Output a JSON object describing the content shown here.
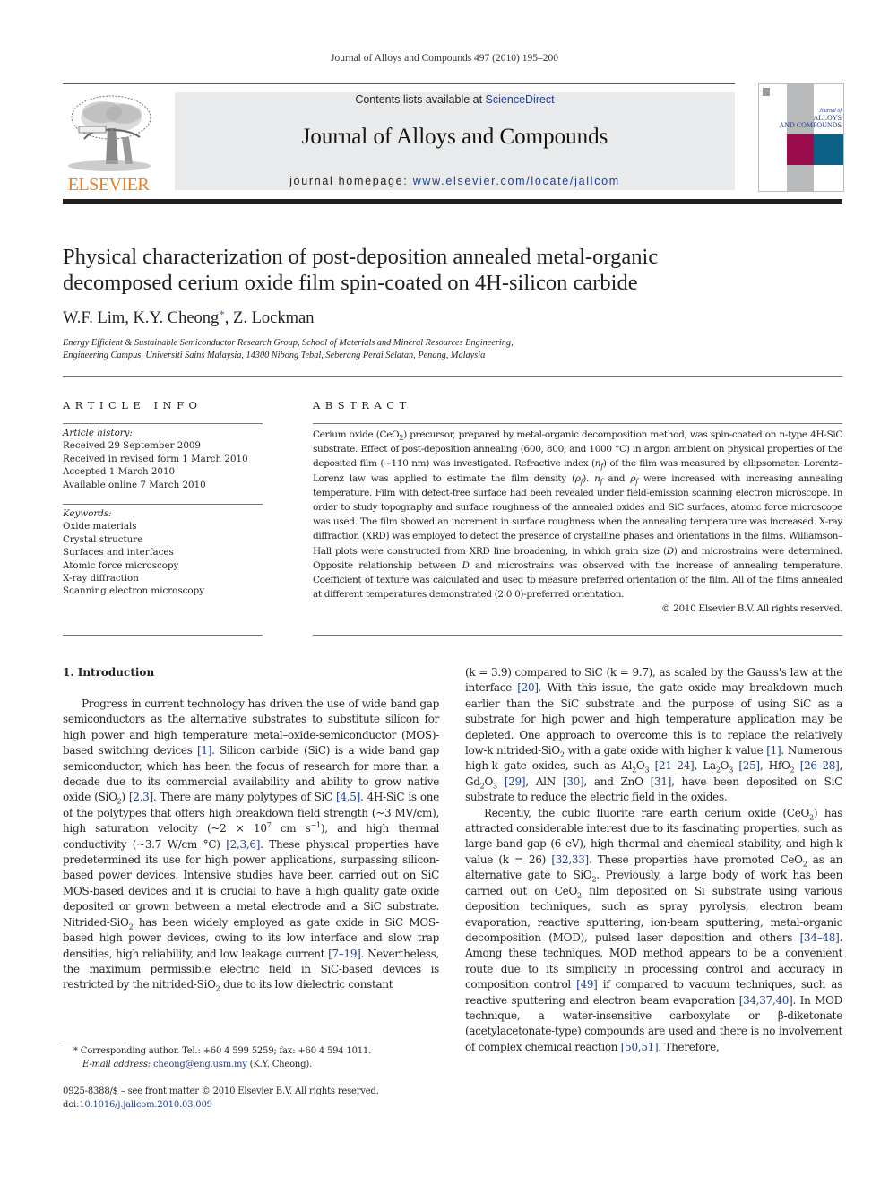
{
  "running_head": "Journal of Alloys and Compounds 497 (2010) 195–200",
  "masthead": {
    "contents_prefix": "Contents lists available at ",
    "contents_link": "ScienceDirect",
    "journal_title": "Journal of Alloys and Compounds",
    "homepage_prefix": "journal homepage: ",
    "homepage_link": "www.elsevier.com/locate/jallcom",
    "publisher_logo_text": "ELSEVIER",
    "cover_title_1": "Journal of",
    "cover_title_2": "ALLOYS",
    "cover_title_3": "AND COMPOUNDS",
    "colors": {
      "publisher_orange": "#f07e1f",
      "link_blue": "#1f3f94",
      "cover_magenta": "#9b0c4c",
      "cover_blue": "#0c6286",
      "cover_grey": "#b9babc",
      "masthead_bg": "#e9eaeb"
    }
  },
  "article": {
    "title_line1": "Physical characterization of post-deposition annealed metal-organic",
    "title_line2": "decomposed cerium oxide film spin-coated on 4H-silicon carbide",
    "authors": [
      {
        "name": "W.F. Lim",
        "sep": ", "
      },
      {
        "name": "K.Y. Cheong",
        "mark": "*",
        "sep": ", "
      },
      {
        "name": "Z. Lockman",
        "sep": ""
      }
    ],
    "affiliation_line1": "Energy Efficient & Sustainable Semiconductor Research Group, School of Materials and Mineral Resources Engineering,",
    "affiliation_line2": "Engineering Campus, Universiti Sains Malaysia, 14300 Nibong Tebal, Seberang Perai Selatan, Penang, Malaysia"
  },
  "article_info": {
    "heading": "ARTICLE INFO",
    "history_label": "Article history:",
    "history": [
      "Received 29 September 2009",
      "Received in revised form 1 March 2010",
      "Accepted 1 March 2010",
      "Available online 7 March 2010"
    ],
    "keywords_label": "Keywords:",
    "keywords": [
      "Oxide materials",
      "Crystal structure",
      "Surfaces and interfaces",
      "Atomic force microscopy",
      "X-ray diffraction",
      "Scanning electron microscopy"
    ]
  },
  "abstract": {
    "heading": "ABSTRACT",
    "p1": "Cerium oxide (CeO",
    "p1_sub": "2",
    "p2": ") precursor, prepared by metal-organic decomposition method, was spin-coated on n-type 4H-SiC substrate. Effect of post-deposition annealing (600, 800, and 1000 °C) in argon ambient on physical properties of the deposited film (~110 nm) was investigated. Refractive index (",
    "nf": "n",
    "f": "f",
    "p3": ") of the film was measured by ellipsometer. Lorentz–Lorenz law was applied to estimate the film density (",
    "rho": "ρ",
    "p4": "). ",
    "p5": " and ",
    "p6": " were increased with increasing annealing temperature. Film with defect-free surface had been revealed under field-emission scanning electron microscope. In order to study topography and surface roughness of the annealed oxides and SiC surfaces, atomic force microscope was used. The film showed an increment in surface roughness when the annealing temperature was increased. X-ray diffraction (XRD) was employed to detect the presence of crystalline phases and orientations in the films. Williamson–Hall plots were constructed from XRD line broadening, in which grain size (",
    "D": "D",
    "p7": ") and microstrains were determined. Opposite relationship between ",
    "p8": " and microstrains was observed with the increase of annealing temperature. Coefficient of texture was calculated and used to measure preferred orientation of the film. All of the films annealed at different temperatures demonstrated (2 0 0)-preferred orientation.",
    "copyright": "© 2010 Elsevier B.V. All rights reserved."
  },
  "intro": {
    "heading": "1.  Introduction",
    "left": {
      "a": "Progress in current technology has driven the use of wide band gap semiconductors as the alternative substrates to substitute silicon for high power and high temperature metal–oxide-semiconductor (MOS)-based switching devices ",
      "r1": "[1]",
      "b": ". Silicon carbide (SiC) is a wide band gap semiconductor, which has been the focus of research for more than a decade due to its commercial availability and ability to grow native oxide (SiO",
      "c": ") ",
      "r2": "[2,3]",
      "d": ". There are many polytypes of SiC ",
      "r3": "[4,5]",
      "e": ". 4H-SiC is one of the polytypes that offers high breakdown field strength (~3 MV/cm), high saturation velocity (~2 × 10",
      "exp7": "7",
      "f": " cm s",
      "expm1": "−1",
      "g": "), and high thermal conductivity (~3.7 W/cm °C) ",
      "r4": "[2,3,6]",
      "h": ". These physical properties have predetermined its use for high power applications, surpassing silicon-based power devices. Intensive studies have been carried out on SiC MOS-based devices and it is crucial to have a high quality gate oxide deposited or grown between a metal electrode and a SiC substrate. Nitrided-SiO",
      "i": " has been widely employed as gate oxide in SiC MOS-based high power devices, owing to its low interface and slow trap densities, high reliability, and low leakage current ",
      "r5": "[7–19]",
      "j": ". Nevertheless, the maximum permissible electric field in SiC-based devices is restricted by the nitrided-SiO",
      "k": " due to its low dielectric constant"
    },
    "right": {
      "a": "(k = 3.9) compared to SiC (k = 9.7), as scaled by the Gauss's law at the interface ",
      "r20": "[20]",
      "b": ". With this issue, the gate oxide may breakdown much earlier than the SiC substrate and the purpose of using SiC as a substrate for high power and high temperature application may be depleted. One approach to overcome this is to replace the relatively low-k nitrided-SiO",
      "c": " with a gate oxide with higher k value ",
      "r1": "[1]",
      "d": ". Numerous high-k gate oxides, such as Al",
      "e": "O",
      "r21": "[21–24]",
      "f": ", La",
      "r25": "[25]",
      "g": ", HfO",
      "r26": "[26–28]",
      "h": ", Gd",
      "r29": "[29]",
      "i": ", AlN ",
      "r30": "[30]",
      "j": ", and ZnO ",
      "r31": "[31]",
      "k": ", have been deposited on SiC substrate to reduce the electric field in the oxides.",
      "p2a": "Recently, the cubic fluorite rare earth cerium oxide (CeO",
      "p2b": ") has attracted considerable interest due to its fascinating properties, such as large band gap (6 eV), high thermal and chemical stability, and high-k value (k = 26) ",
      "r32": "[32,33]",
      "p2c": ". These properties have promoted CeO",
      "p2d": " as an alternative gate to SiO",
      "p2e": ". Previously, a large body of work has been carried out on CeO",
      "p2f": " film deposited on Si substrate using various deposition techniques, such as spray pyrolysis, electron beam evaporation, reactive sputtering, ion-beam sputtering, metal-organic decomposition (MOD), pulsed laser deposition and others ",
      "r34": "[34–48]",
      "p2g": ". Among these techniques, MOD method appears to be a convenient route due to its simplicity in processing control and accuracy in composition control ",
      "r49": "[49]",
      "p2h": " if compared to vacuum techniques, such as reactive sputtering and electron beam evaporation ",
      "r3440": "[34,37,40]",
      "p2i": ". In MOD technique, a water-insensitive carboxylate or β-diketonate (acetylacetonate-type) compounds are used and there is no involvement of complex chemical reaction ",
      "r50": "[50,51]",
      "p2j": ". Therefore,"
    }
  },
  "footnote": {
    "mark": "*",
    "corresponding": " Corresponding author. Tel.: +60 4 599 5259; fax: +60 4 594 1011.",
    "email_label": "E-mail address: ",
    "email": "cheong@eng.usm.my",
    "email_suffix": " (K.Y. Cheong).",
    "frontmatter": "0925-8388/$ – see front matter © 2010 Elsevier B.V. All rights reserved.",
    "doi_prefix": "doi:",
    "doi": "10.1016/j.jallcom.2010.03.009"
  }
}
